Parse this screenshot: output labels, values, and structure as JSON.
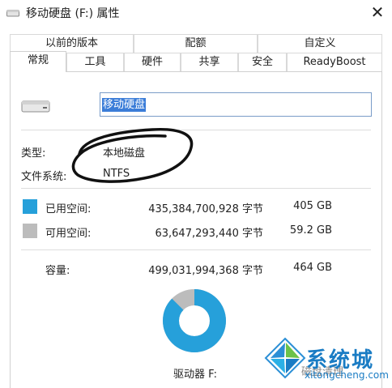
{
  "window": {
    "title": "移动硬盘 (F:) 属性",
    "close_glyph": "✕"
  },
  "tabs": {
    "row1": [
      "以前的版本",
      "配额",
      "自定义"
    ],
    "row2": [
      "常规",
      "工具",
      "硬件",
      "共享",
      "安全",
      "ReadyBoost"
    ],
    "active": "常规"
  },
  "general": {
    "drive_name": "移动硬盘",
    "type_label": "类型:",
    "type_value": "本地磁盘",
    "fs_label": "文件系统:",
    "fs_value": "NTFS",
    "used_label": "已用空间:",
    "used_bytes": "435,384,700,928 字节",
    "used_size": "405 GB",
    "free_label": "可用空间:",
    "free_bytes": "63,647,293,440 字节",
    "free_size": "59.2 GB",
    "capacity_label": "容量:",
    "capacity_bytes": "499,031,994,368 字节",
    "capacity_size": "464 GB",
    "drive_label": "驱动器 F:",
    "cleanup_partial": "磁盘清理"
  },
  "usage": {
    "used_fraction": 0.8725,
    "used_color": "#26a0da",
    "free_color": "#bcbcbc"
  },
  "watermark": {
    "cn": "系统城",
    "en": "xitongcheng.com",
    "color": "#1a7cc4"
  }
}
